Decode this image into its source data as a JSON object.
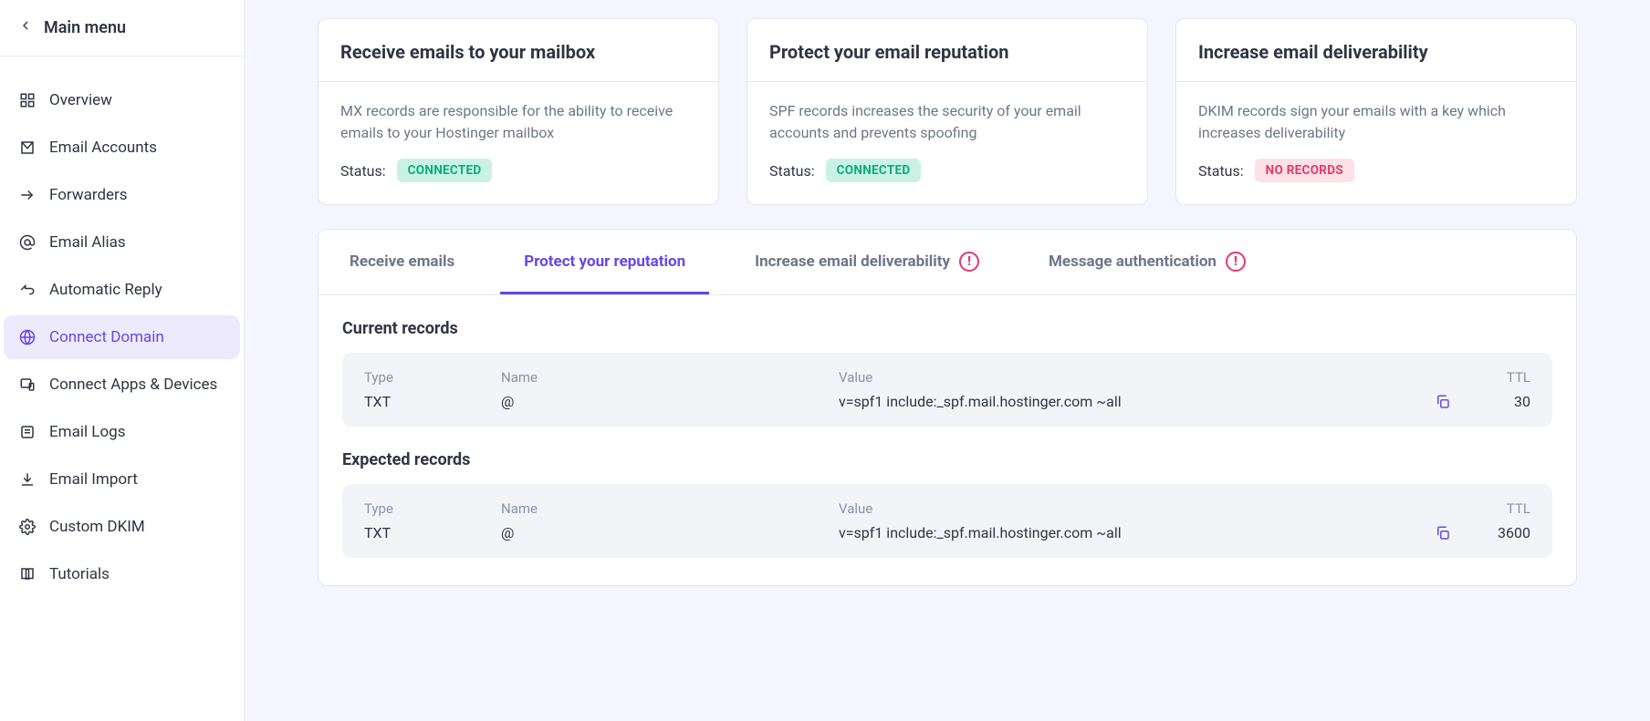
{
  "sidebar": {
    "back_label": "Main menu",
    "items": [
      {
        "label": "Overview",
        "icon": "grid"
      },
      {
        "label": "Email Accounts",
        "icon": "mail"
      },
      {
        "label": "Forwarders",
        "icon": "forward"
      },
      {
        "label": "Email Alias",
        "icon": "at"
      },
      {
        "label": "Automatic Reply",
        "icon": "reply"
      },
      {
        "label": "Connect Domain",
        "icon": "globe",
        "active": true
      },
      {
        "label": "Connect Apps & Devices",
        "icon": "device"
      },
      {
        "label": "Email Logs",
        "icon": "log"
      },
      {
        "label": "Email Import",
        "icon": "download"
      },
      {
        "label": "Custom DKIM",
        "icon": "gear"
      },
      {
        "label": "Tutorials",
        "icon": "book"
      }
    ]
  },
  "cards": [
    {
      "title": "Receive emails to your mailbox",
      "desc": "MX records are responsible for the ability to receive emails to your Hostinger mailbox",
      "status_label": "Status:",
      "status_value": "CONNECTED",
      "status_class": "connected"
    },
    {
      "title": "Protect your email reputation",
      "desc": "SPF records increases the security of your email accounts and prevents spoofing",
      "status_label": "Status:",
      "status_value": "CONNECTED",
      "status_class": "connected"
    },
    {
      "title": "Increase email deliverability",
      "desc": "DKIM records sign your emails with a key which increases deliverability",
      "status_label": "Status:",
      "status_value": "NO RECORDS",
      "status_class": "norecords"
    }
  ],
  "tabs": [
    {
      "label": "Receive emails",
      "warn": false,
      "active": false
    },
    {
      "label": "Protect your reputation",
      "warn": false,
      "active": true
    },
    {
      "label": "Increase email deliverability",
      "warn": true,
      "active": false
    },
    {
      "label": "Message authentication",
      "warn": true,
      "active": false
    }
  ],
  "current_records": {
    "heading": "Current records",
    "headers": {
      "type": "Type",
      "name": "Name",
      "value": "Value",
      "ttl": "TTL"
    },
    "rows": [
      {
        "type": "TXT",
        "name": "@",
        "value": "v=spf1 include:_spf.mail.hostinger.com ~all",
        "ttl": "30"
      }
    ]
  },
  "expected_records": {
    "heading": "Expected records",
    "headers": {
      "type": "Type",
      "name": "Name",
      "value": "Value",
      "ttl": "TTL"
    },
    "rows": [
      {
        "type": "TXT",
        "name": "@",
        "value": "v=spf1 include:_spf.mail.hostinger.com ~all",
        "ttl": "3600"
      }
    ]
  }
}
